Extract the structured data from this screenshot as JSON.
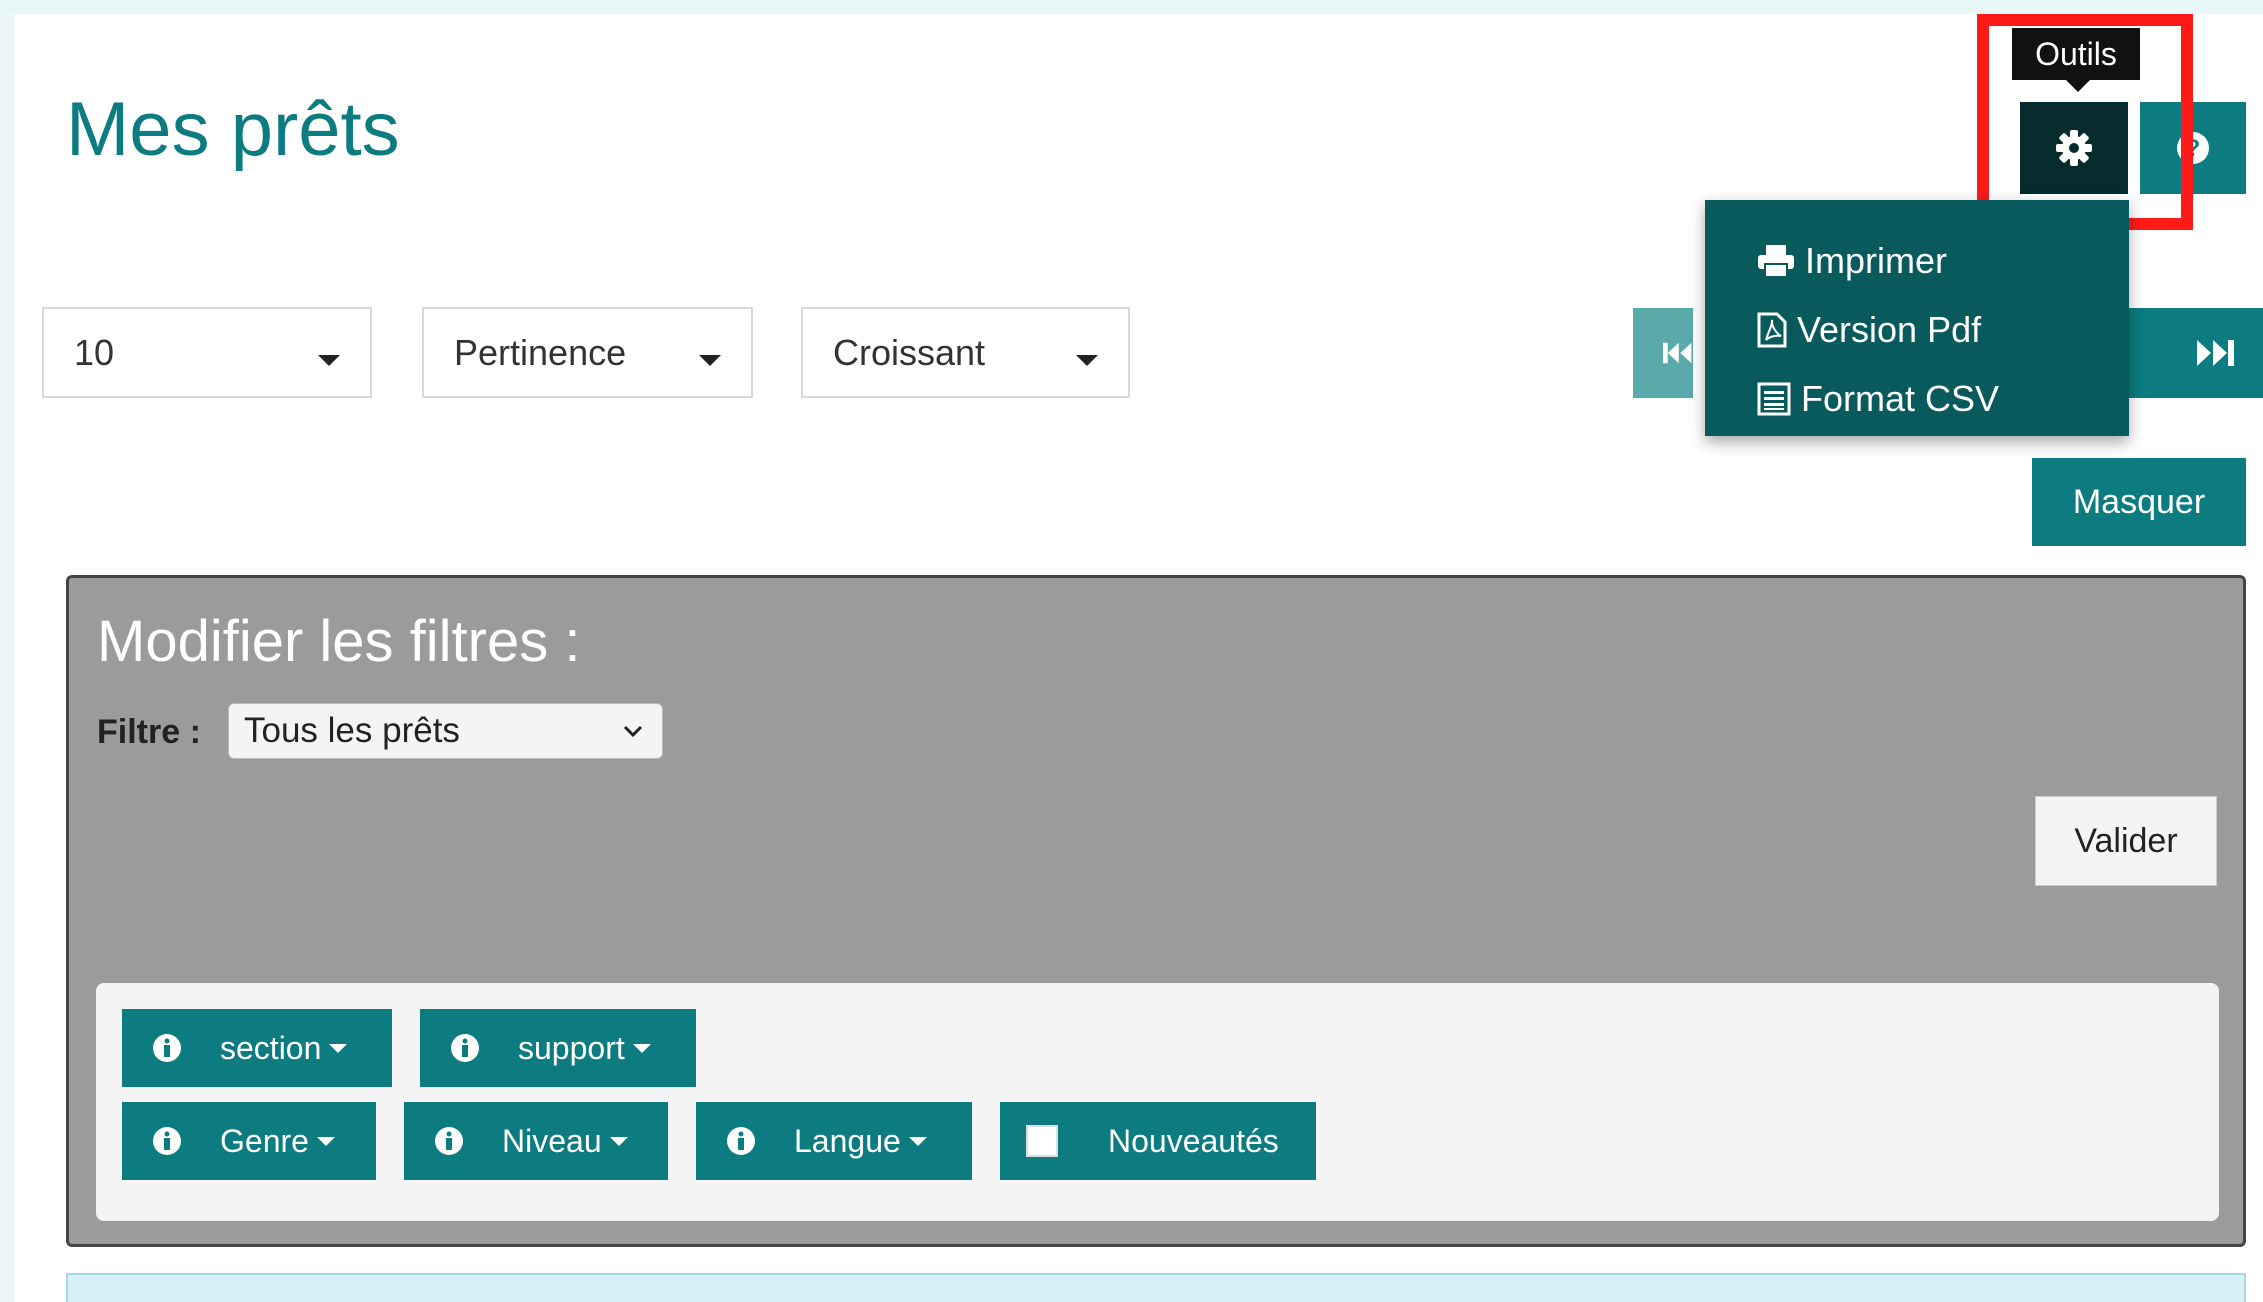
{
  "page": {
    "title": "Mes prêts"
  },
  "sort_controls": {
    "per_page": "10",
    "sort_by": "Pertinence",
    "order": "Croissant"
  },
  "toolbar": {
    "tooltip": "Outils",
    "menu": [
      {
        "label": "Imprimer",
        "icon": "print-icon"
      },
      {
        "label": "Version Pdf",
        "icon": "pdf-icon"
      },
      {
        "label": "Format CSV",
        "icon": "csv-icon"
      }
    ],
    "hide_label": "Masquer"
  },
  "filters": {
    "title": "Modifier les filtres :",
    "label": "Filtre :",
    "selected": "Tous les prêts",
    "submit": "Valider",
    "facets": [
      "section",
      "support",
      "Genre",
      "Niveau",
      "Langue"
    ],
    "new_items_label": "Nouveautés"
  },
  "colors": {
    "accent": "#0c7c80",
    "accent_dark": "#062b2c",
    "menu_bg": "#085a5d",
    "panel_bg": "#9b9b9b",
    "highlight": "#ff1a1a"
  }
}
